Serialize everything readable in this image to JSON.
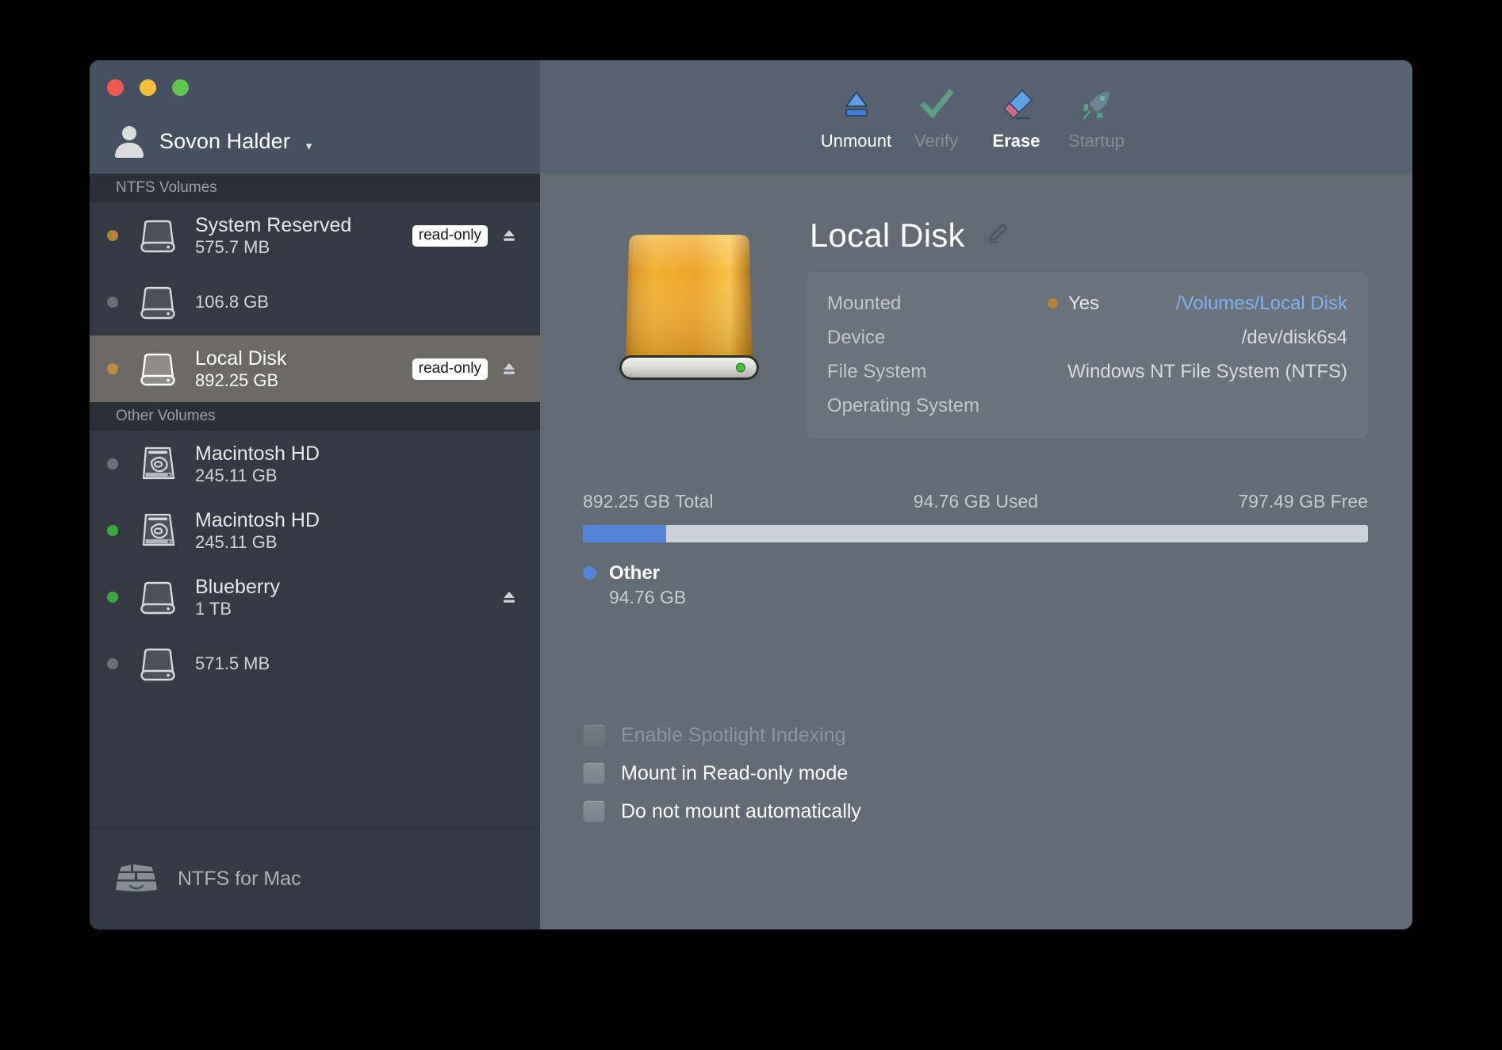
{
  "window": {
    "traffic_lights": [
      "close",
      "minimize",
      "zoom"
    ]
  },
  "sidebar": {
    "account": {
      "name": "Sovon Halder",
      "chevron": "chevron-down-icon"
    },
    "sections": [
      {
        "title": "NTFS Volumes",
        "volumes": [
          {
            "name": "System Reserved",
            "size": "575.7 MB",
            "dot": "#b5823a",
            "badge": "read-only",
            "eject": true,
            "icon": "external-drive-icon",
            "selected": false
          },
          {
            "name": "",
            "size": "106.8 GB",
            "dot": "#6b7078",
            "badge": "",
            "eject": false,
            "icon": "external-drive-icon",
            "selected": false
          },
          {
            "name": "Local Disk",
            "size": "892.25 GB",
            "dot": "#c08b3f",
            "badge": "read-only",
            "eject": true,
            "icon": "external-drive-icon",
            "selected": true
          }
        ]
      },
      {
        "title": "Other Volumes",
        "volumes": [
          {
            "name": "Macintosh HD",
            "size": "245.11 GB",
            "dot": "#6b7078",
            "badge": "",
            "eject": false,
            "icon": "internal-hard-drive-icon",
            "selected": false
          },
          {
            "name": "Macintosh HD",
            "size": "245.11 GB",
            "dot": "#3da83d",
            "badge": "",
            "eject": false,
            "icon": "internal-hard-drive-icon",
            "selected": false
          },
          {
            "name": "Blueberry",
            "size": "1 TB",
            "dot": "#3da83d",
            "badge": "",
            "eject": true,
            "icon": "external-drive-icon",
            "selected": false
          },
          {
            "name": "",
            "size": "571.5 MB",
            "dot": "#6b7078",
            "badge": "",
            "eject": false,
            "icon": "external-drive-icon",
            "selected": false
          }
        ]
      }
    ],
    "footer": {
      "label": "NTFS for Mac",
      "icon": "ntfs-for-mac-icon"
    }
  },
  "toolbar": {
    "buttons": [
      {
        "label": "Unmount",
        "icon": "eject-icon",
        "state": "enabled"
      },
      {
        "label": "Verify",
        "icon": "checkmark-icon",
        "state": "disabled"
      },
      {
        "label": "Erase",
        "icon": "eraser-icon",
        "state": "active"
      },
      {
        "label": "Startup",
        "icon": "rocket-icon",
        "state": "disabled"
      }
    ]
  },
  "detail": {
    "drive_art": "orange-external-drive-illustration",
    "title": "Local Disk",
    "edit_icon": "pencil-edit-icon",
    "info_rows": [
      {
        "label": "Mounted",
        "mid": "Yes",
        "mid_dot": "#b5823a",
        "value": "/Volumes/Local Disk",
        "is_link": true
      },
      {
        "label": "Device",
        "mid": "",
        "value": "/dev/disk6s4",
        "is_link": false
      },
      {
        "label": "File System",
        "mid": "",
        "value": "Windows NT File System (NTFS)",
        "is_link": false
      },
      {
        "label": "Operating System",
        "mid": "",
        "value": "",
        "is_link": false
      }
    ],
    "capacity": {
      "total_label": "892.25 GB Total",
      "used_label": "94.76 GB Used",
      "free_label": "797.49 GB Free",
      "used_percent": 10.6,
      "bar_color": "#5286d8",
      "track_color": "#ccd2da",
      "legend": [
        {
          "name": "Other",
          "size": "94.76 GB",
          "color": "#5286d8"
        }
      ]
    },
    "options": [
      {
        "label": "Enable Spotlight Indexing",
        "checked": false,
        "disabled": true
      },
      {
        "label": "Mount in Read-only mode",
        "checked": false,
        "disabled": false
      },
      {
        "label": "Do not mount automatically",
        "checked": false,
        "disabled": false
      }
    ]
  }
}
